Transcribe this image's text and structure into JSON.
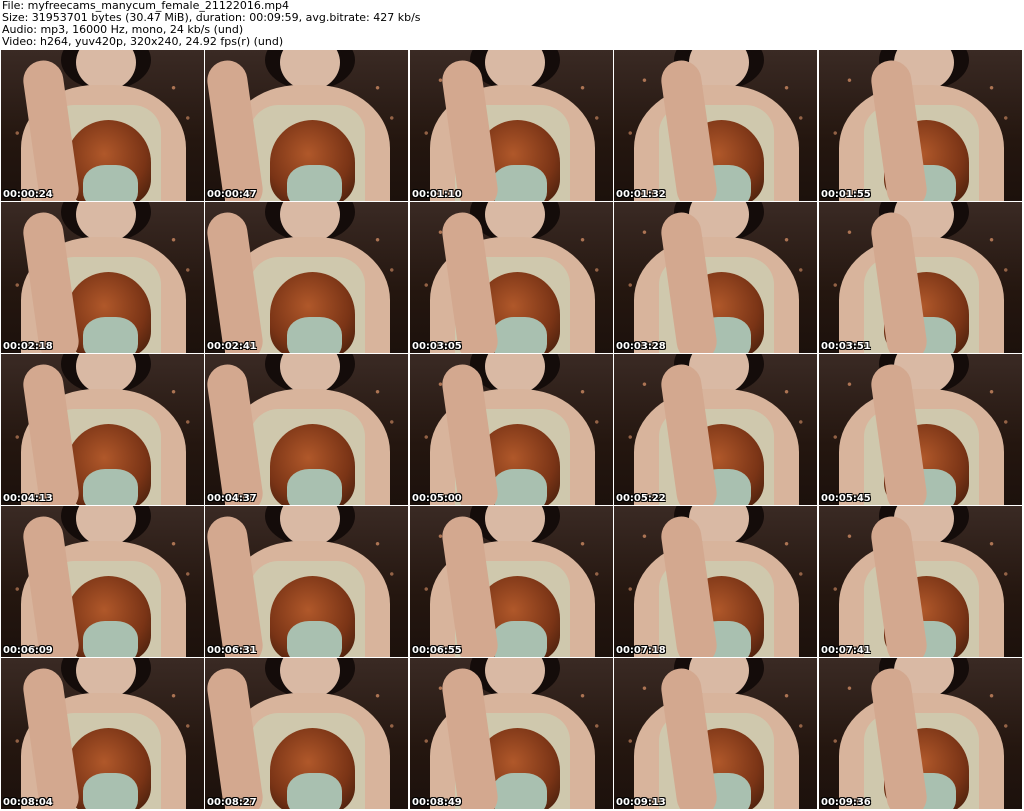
{
  "header": {
    "file": "File: myfreecams_manycum_female_21122016.mp4",
    "size": "Size: 31953701 bytes (30.47 MiB), duration: 00:09:59, avg.bitrate: 427 kb/s",
    "audio": "Audio: mp3, 16000 Hz, mono, 24 kb/s (und)",
    "video": "Video: h264, yuv420p, 320x240, 24.92 fps(r) (und)"
  },
  "thumbnails": [
    "00:00:24",
    "00:00:47",
    "00:01:10",
    "00:01:32",
    "00:01:55",
    "00:02:18",
    "00:02:41",
    "00:03:05",
    "00:03:28",
    "00:03:51",
    "00:04:13",
    "00:04:37",
    "00:05:00",
    "00:05:22",
    "00:05:45",
    "00:06:09",
    "00:06:31",
    "00:06:55",
    "00:07:18",
    "00:07:41",
    "00:08:04",
    "00:08:27",
    "00:08:49",
    "00:09:13",
    "00:09:36"
  ]
}
